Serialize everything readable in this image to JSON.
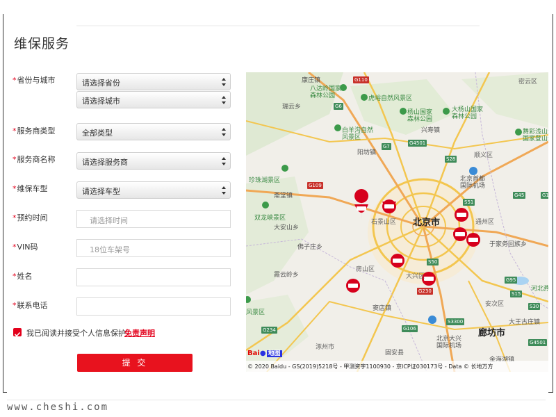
{
  "page": {
    "title": "维保服务"
  },
  "form": {
    "fields": [
      {
        "label": "省份与城市",
        "required_mark": "*"
      },
      {
        "label": "服务商类型",
        "required_mark": "*"
      },
      {
        "label": "服务商名称",
        "required_mark": "*"
      },
      {
        "label": "维保车型",
        "required_mark": "*"
      },
      {
        "label": "预约时间",
        "required_mark": "*"
      },
      {
        "label": "VIN码",
        "required_mark": "*"
      },
      {
        "label": "姓名",
        "required_mark": "*"
      },
      {
        "label": "联系电话",
        "required_mark": "*"
      }
    ],
    "province_select": "请选择省份",
    "city_select": "请选择城市",
    "provider_type_select": "全部类型",
    "provider_name_select": "请选择服务商",
    "model_select": "请选择车型",
    "time_placeholder": "请选择时间",
    "vin_placeholder": "18位车架号",
    "name_value": "",
    "phone_value": "",
    "agree_text": "我已阅读并接受个人信息保护",
    "agree_link": "免责声明",
    "submit_label": "提 交"
  },
  "map": {
    "places": [
      {
        "text": "康庄镇",
        "kind": ""
      },
      {
        "text": "八达岭国家",
        "kind": "green"
      },
      {
        "text": "森林公园",
        "kind": "green"
      },
      {
        "text": "虎峪自然风景区",
        "kind": "green"
      },
      {
        "text": "密云区",
        "kind": "district"
      },
      {
        "text": "杨山国家",
        "kind": "green"
      },
      {
        "text": "森林公园",
        "kind": "green"
      },
      {
        "text": "大杨山国家",
        "kind": "green"
      },
      {
        "text": "森林公园",
        "kind": "green"
      },
      {
        "text": "瑞云乡",
        "kind": ""
      },
      {
        "text": "兴寿镇",
        "kind": ""
      },
      {
        "text": "白羊沟自然",
        "kind": "green"
      },
      {
        "text": "风景区",
        "kind": "green"
      },
      {
        "text": "舞彩浅山滨水",
        "kind": "green"
      },
      {
        "text": "国家登山步道",
        "kind": "green"
      },
      {
        "text": "阳坊镇",
        "kind": ""
      },
      {
        "text": "顺义区",
        "kind": "district"
      },
      {
        "text": "珍珠湖景区",
        "kind": "green"
      },
      {
        "text": "北京首都",
        "kind": ""
      },
      {
        "text": "国际机场",
        "kind": ""
      },
      {
        "text": "斋堂镇",
        "kind": ""
      },
      {
        "text": "双龙峡景区",
        "kind": "green"
      },
      {
        "text": "石景山区",
        "kind": "district"
      },
      {
        "text": "北京市",
        "kind": "city"
      },
      {
        "text": "通州区",
        "kind": "district"
      },
      {
        "text": "大安山乡",
        "kind": ""
      },
      {
        "text": "佛子庄乡",
        "kind": ""
      },
      {
        "text": "于家务回族乡",
        "kind": ""
      },
      {
        "text": "房山区",
        "kind": "district"
      },
      {
        "text": "大兴区",
        "kind": "district"
      },
      {
        "text": "霞云岭乡",
        "kind": ""
      },
      {
        "text": "河北燕郊",
        "kind": "green"
      },
      {
        "text": "窦店镇",
        "kind": ""
      },
      {
        "text": "安次区",
        "kind": "district"
      },
      {
        "text": "风景区",
        "kind": "green"
      },
      {
        "text": "北京大兴",
        "kind": ""
      },
      {
        "text": "国际机场",
        "kind": ""
      },
      {
        "text": "大王古庄镇",
        "kind": ""
      },
      {
        "text": "廊坊市",
        "kind": "city"
      },
      {
        "text": "涿州市",
        "kind": "district"
      },
      {
        "text": "金海湖镇",
        "kind": ""
      },
      {
        "text": "固安县",
        "kind": ""
      }
    ],
    "roads": [
      "G110",
      "G6",
      "G7",
      "G4501",
      "G109",
      "G1",
      "S28",
      "G45",
      "S51",
      "S50",
      "G95",
      "S15",
      "S30",
      "G230",
      "G234",
      "G106",
      "S3300",
      "G4501"
    ],
    "copyright": "© 2020 Baidu - GS(2019)5218号 - 甲测资字1100930 - 京ICP证030173号 - Data © 长地万方",
    "logo_bai": "Bai",
    "logo_du": "地图"
  },
  "watermark": "www.cheshi.com",
  "colors": {
    "accent": "#e8121e",
    "map_bg": "#f1efe9",
    "road_yellow": "#f7d36b",
    "road_orange": "#f0a856",
    "park_green": "#cfe7c1"
  }
}
